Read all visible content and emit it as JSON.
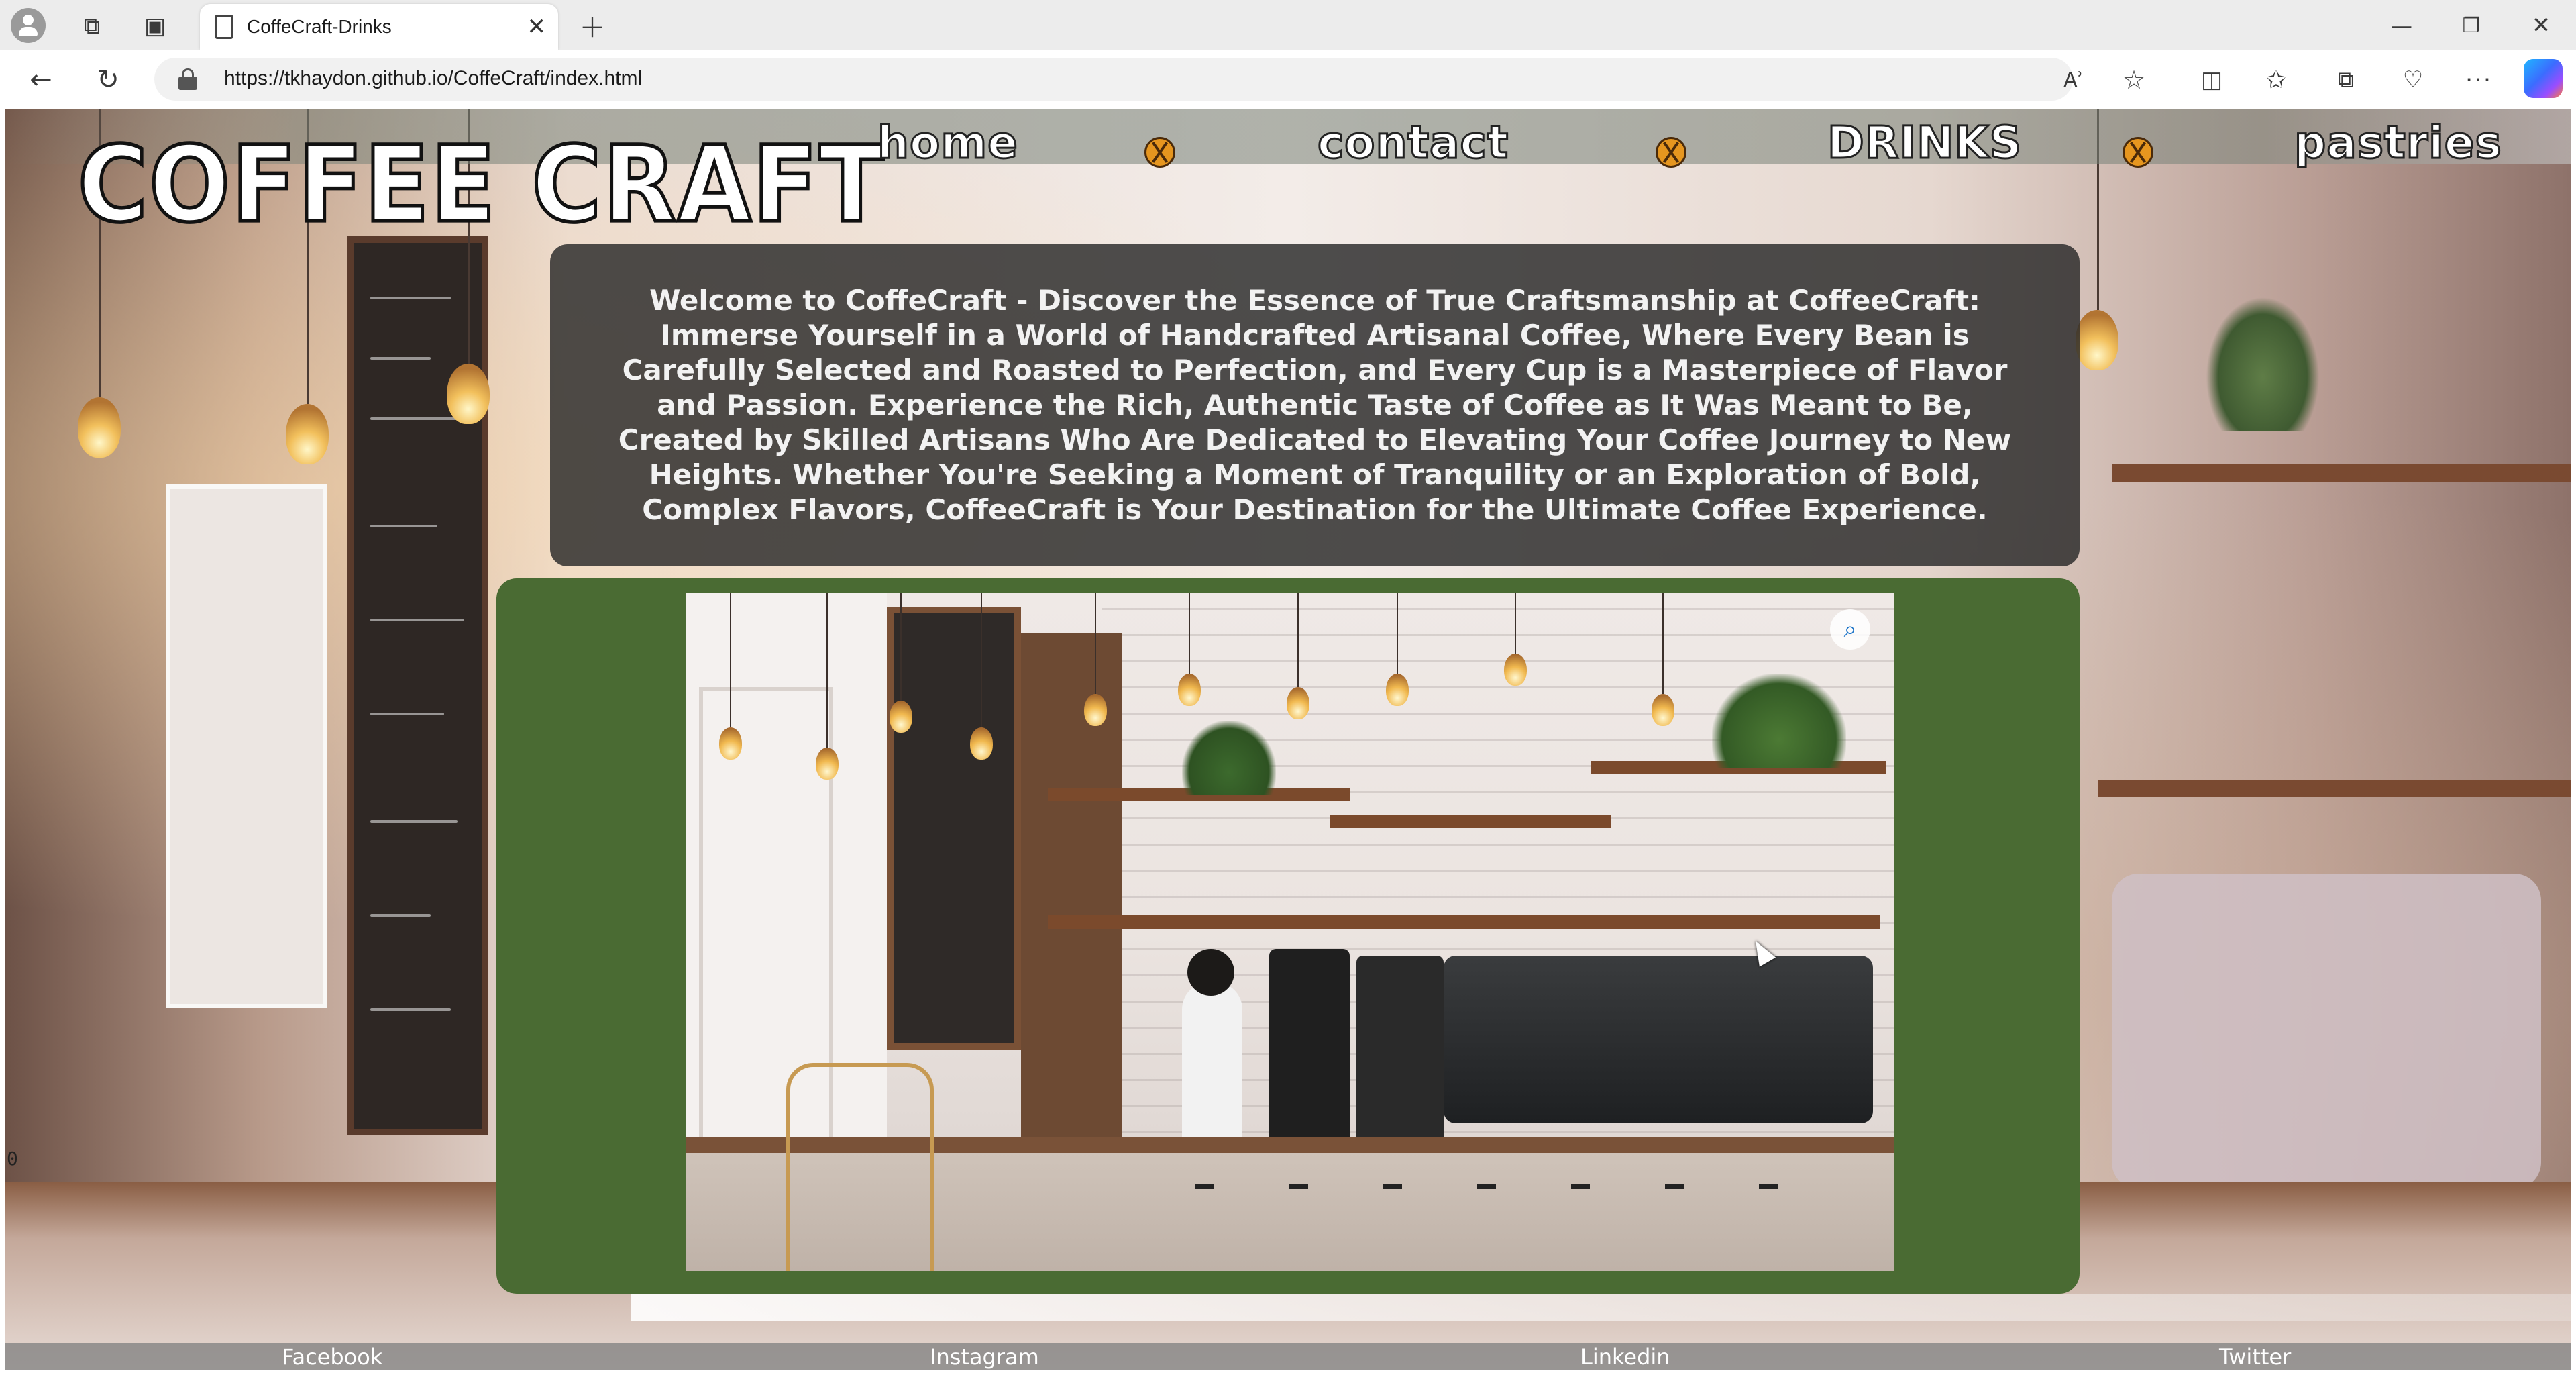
{
  "browser": {
    "tab_title": "CoffeCraft-Drinks",
    "url": "https://tkhaydon.github.io/CoffeCraft/index.html",
    "icons": {
      "profile": "profile-icon",
      "workspaces": "workspaces-icon",
      "tab_actions": "tab-actions-icon",
      "tab_page": "page-icon",
      "tab_close": "close-icon",
      "new_tab": "plus-icon",
      "minimize": "minimize-icon",
      "restore": "restore-icon",
      "close_window": "close-icon",
      "back": "back-arrow-icon",
      "reload": "reload-icon",
      "lock": "lock-icon",
      "read_aloud": "read-aloud-icon",
      "favorite": "star-icon",
      "split_screen": "split-screen-icon",
      "favorites": "favorites-icon",
      "collections": "collections-icon",
      "performance": "heart-pulse-icon",
      "more": "more-icon",
      "copilot": "copilot-icon"
    },
    "glyphs": {
      "workspaces": "⧉",
      "tab_actions": "▣",
      "tab_close": "✕",
      "new_tab": "+",
      "minimize": "—",
      "restore": "❐",
      "close_window": "✕",
      "back": "←",
      "reload": "↻",
      "read_aloud": "Aʾ",
      "favorite": "☆",
      "split_screen": "◫",
      "favorites": "✩",
      "collections": "⧉",
      "performance": "♡",
      "more": "···"
    }
  },
  "site": {
    "logo": "COFFEE CRAFT",
    "nav": [
      {
        "label": "Home"
      },
      {
        "label": "Contact"
      },
      {
        "label": "DRINKS"
      },
      {
        "label": "Pastries"
      }
    ],
    "welcome_text": "Welcome to CoffeCraft - Discover the Essence of True Craftsmanship at CoffeeCraft: Immerse Yourself in a World of Handcrafted Artisanal Coffee, Where Every Bean is Carefully Selected and Roasted to Perfection, and Every Cup is a Masterpiece of Flavor and Passion. Experience the Rich, Authentic Taste of Coffee as It Was Meant to Be, Created by Skilled Artisans Who Are Dedicated to Elevating Your Coffee Journey to New Heights. Whether You're Seeking a Moment of Tranquility or an Exploration of Bold, Complex Flavors, CoffeeCraft is Your Destination for the Ultimate Coffee Experience.",
    "stray_text": "0",
    "footer": [
      {
        "label": "Facebook"
      },
      {
        "label": "Instagram"
      },
      {
        "label": "Linkedin"
      },
      {
        "label": "Twitter"
      }
    ]
  },
  "colors": {
    "image_panel": "#4a6b33",
    "welcome_panel": "#282828",
    "nav_separator": "#e6961f",
    "footer_bar": "#7d7d7d"
  }
}
